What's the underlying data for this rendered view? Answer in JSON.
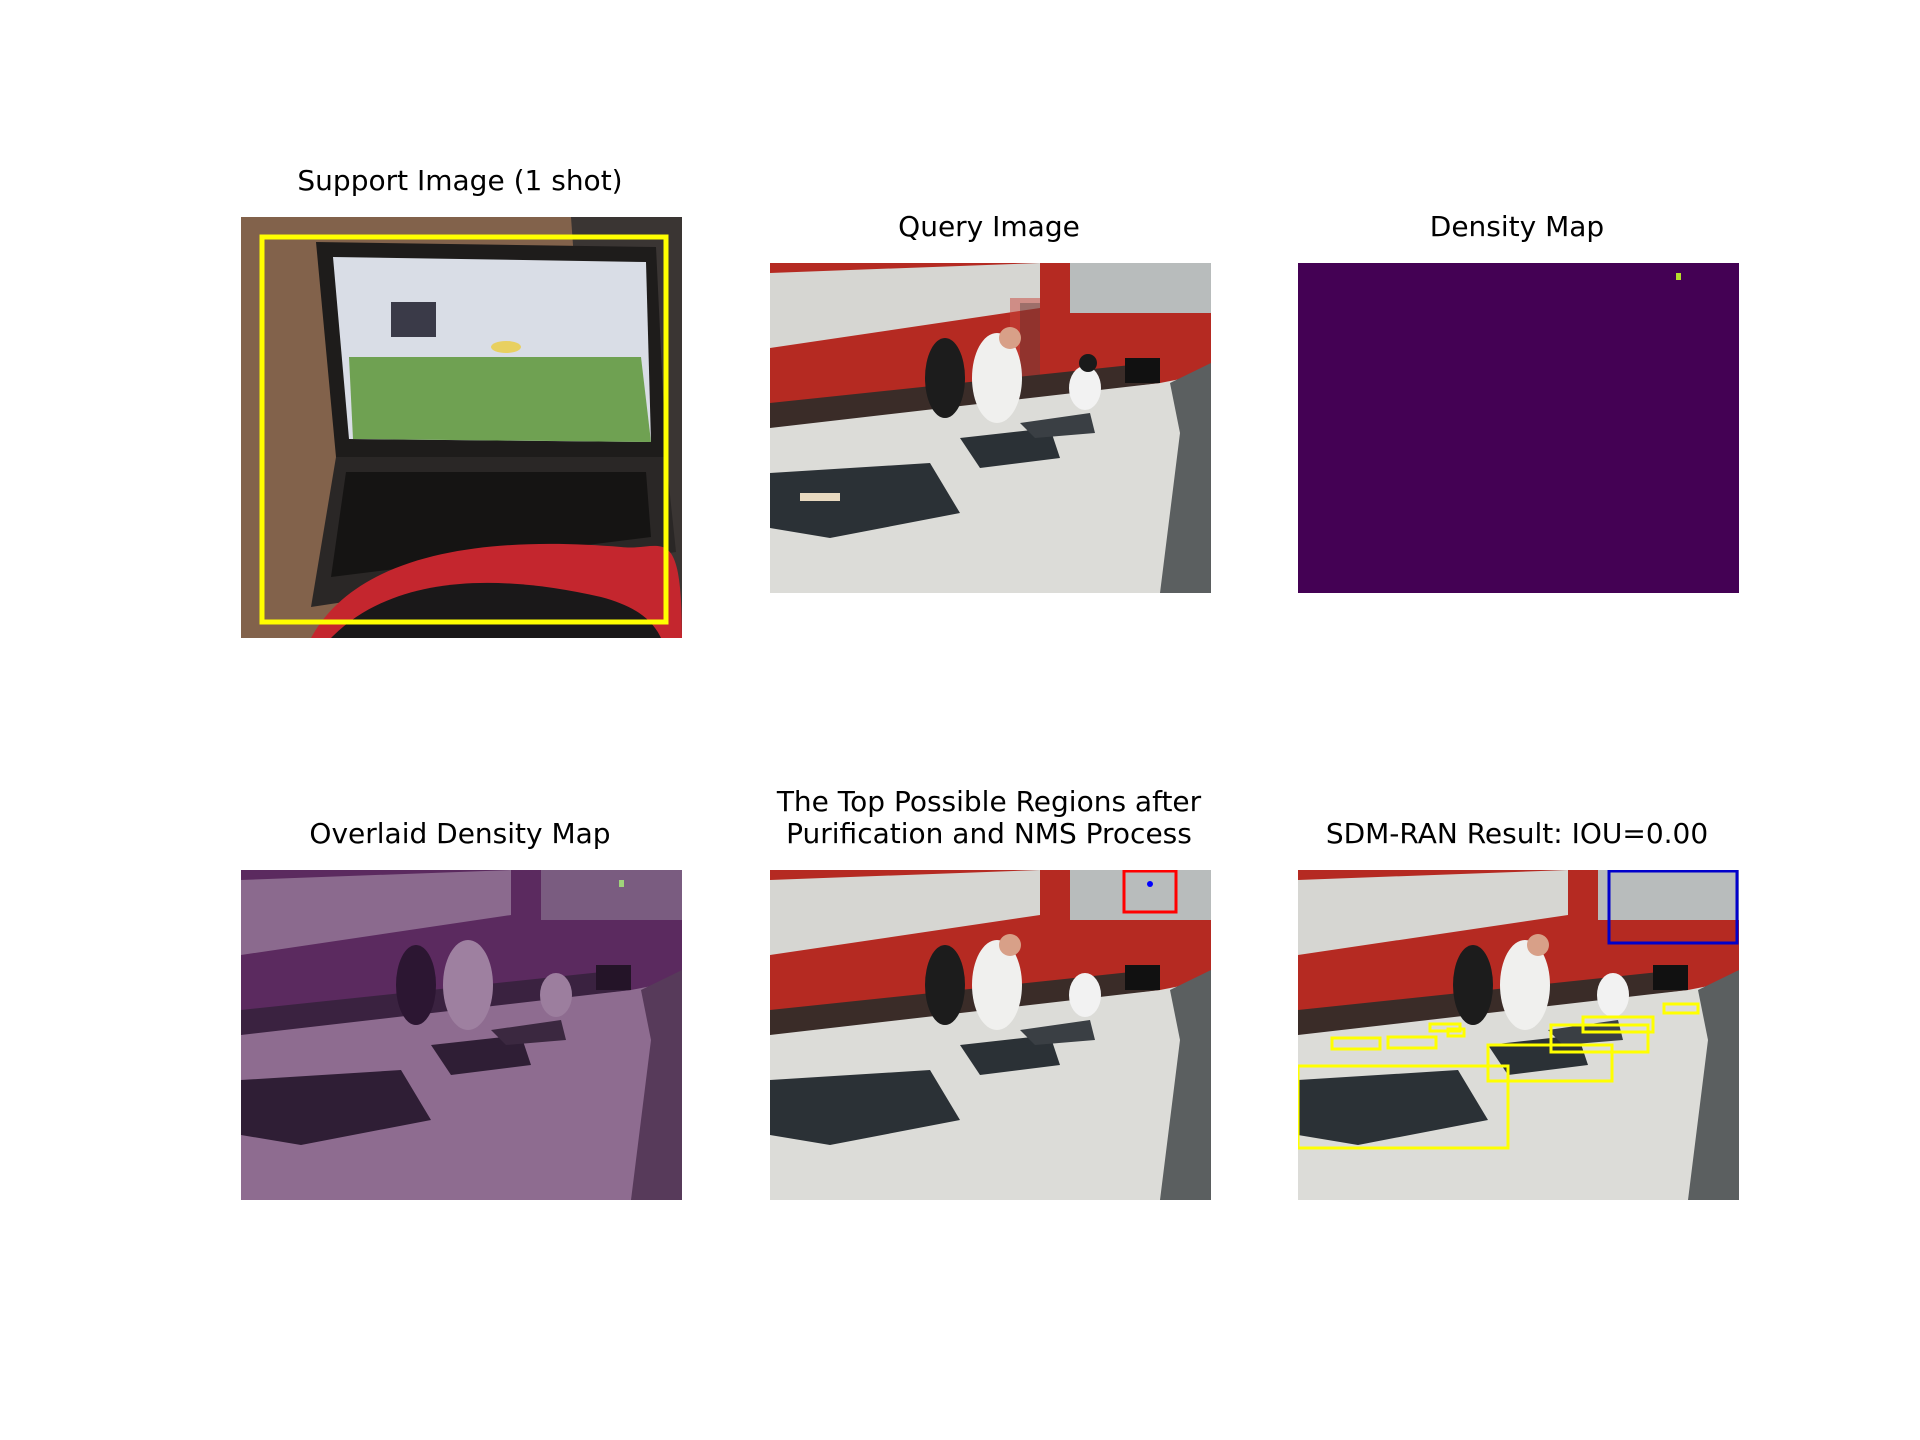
{
  "figure": {
    "panels": [
      {
        "id": "support",
        "title": "Support Image (1 shot)"
      },
      {
        "id": "query",
        "title": "Query Image"
      },
      {
        "id": "density",
        "title": "Density Map"
      },
      {
        "id": "overlay",
        "title": "Overlaid Density Map"
      },
      {
        "id": "regions",
        "title": "The Top Possible Regions after\nPurification and NMS Process"
      },
      {
        "id": "result",
        "title": "SDM-RAN Result: IOU=0.00"
      }
    ]
  },
  "colors": {
    "support_box": "#ffff00",
    "density_background": "#440154",
    "density_peak": "#b5de2b",
    "candidate_box": "#ff0000",
    "ground_truth_box": "#ffff00",
    "predicted_box": "#0000cc",
    "point_marker": "#0000ff"
  }
}
